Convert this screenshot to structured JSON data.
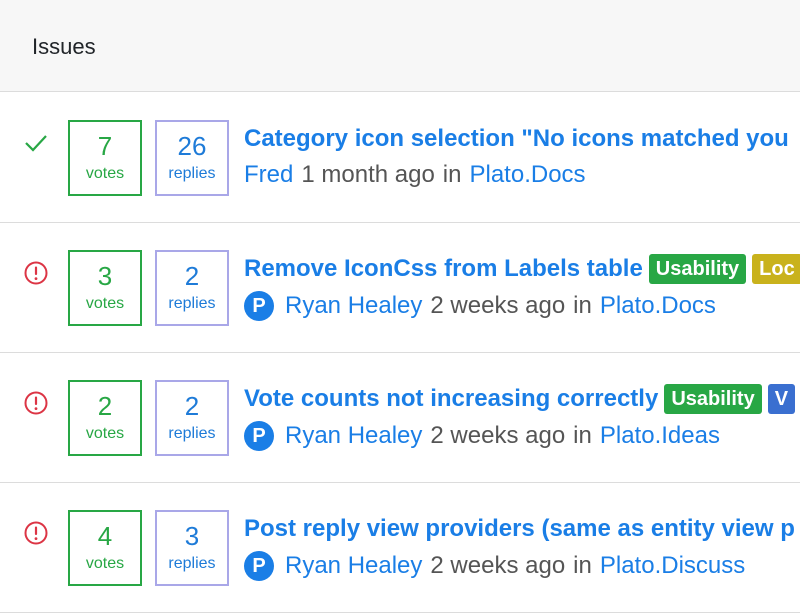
{
  "header": {
    "title": "Issues"
  },
  "issues": [
    {
      "status": "resolved",
      "votes": "7",
      "votes_label": "votes",
      "replies": "26",
      "replies_label": "replies",
      "title": "Category icon selection \"No icons matched you",
      "tags": [],
      "author": "Fred",
      "has_avatar": false,
      "time": "1 month ago",
      "in_label": "in",
      "category": "Plato.Docs"
    },
    {
      "status": "open",
      "votes": "3",
      "votes_label": "votes",
      "replies": "2",
      "replies_label": "replies",
      "title": "Remove IconCss from Labels table",
      "tags": [
        {
          "label": "Usability",
          "color": "#28a745"
        },
        {
          "label": "Loc",
          "color": "#c9b21c"
        }
      ],
      "author": "Ryan Healey",
      "has_avatar": true,
      "avatar_letter": "P",
      "time": "2 weeks ago",
      "in_label": "in",
      "category": "Plato.Docs"
    },
    {
      "status": "open",
      "votes": "2",
      "votes_label": "votes",
      "replies": "2",
      "replies_label": "replies",
      "title": "Vote counts not increasing correctly",
      "tags": [
        {
          "label": "Usability",
          "color": "#28a745"
        },
        {
          "label": "V",
          "color": "#3a6fd0"
        }
      ],
      "author": "Ryan Healey",
      "has_avatar": true,
      "avatar_letter": "P",
      "time": "2 weeks ago",
      "in_label": "in",
      "category": "Plato.Ideas"
    },
    {
      "status": "open",
      "votes": "4",
      "votes_label": "votes",
      "replies": "3",
      "replies_label": "replies",
      "title": "Post reply view providers (same as entity view p",
      "tags": [],
      "author": "Ryan Healey",
      "has_avatar": true,
      "avatar_letter": "P",
      "time": "2 weeks ago",
      "in_label": "in",
      "category": "Plato.Discuss"
    }
  ],
  "colors": {
    "accent": "#1a7ee6",
    "votes": "#28a745",
    "replies_border": "#a9a7e8",
    "open_icon": "#dc3545",
    "resolved_icon": "#28a745"
  },
  "icons": {
    "resolved": "check-icon",
    "open": "alert-circle-icon"
  }
}
